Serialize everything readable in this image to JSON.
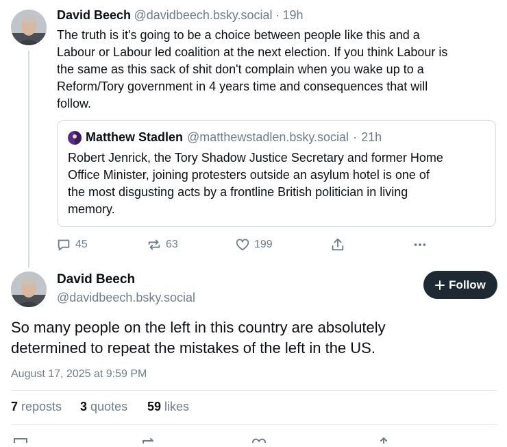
{
  "parent_post": {
    "author_name": "David Beech",
    "author_handle": "@davidbeech.bsky.social",
    "separator": "·",
    "time": "19h",
    "lines": [
      "The truth is it's going to be a choice between people like this and a",
      "Labour or Labour led coalition at the next election. If you think Labour is",
      "the same as this sack of shit don't complain when you wake up to a",
      "Reform/Tory government in 4 years time and consequences that will",
      "follow."
    ],
    "quote": {
      "author_name": "Matthew Stadlen",
      "author_handle": "@matthewstadlen.bsky.social",
      "separator": "·",
      "time": "21h",
      "lines": [
        "Robert Jenrick, the Tory Shadow Justice Secretary and former Home",
        "Office Minister, joining protesters outside an asylum hotel is one of",
        "the most disgusting acts by a frontline British politician in living",
        "memory."
      ]
    },
    "actions": {
      "replies": "45",
      "reposts": "63",
      "likes": "199"
    }
  },
  "main_post": {
    "author_name": "David Beech",
    "author_handle": "@davidbeech.bsky.social",
    "follow_label": "Follow",
    "lines": [
      "So many people on the left in this country are absolutely",
      "determined to repeat the mistakes of the left in the US."
    ],
    "timestamp": "August 17, 2025 at 9:59 PM",
    "stats": {
      "reposts_count": "7",
      "reposts_label": "reposts",
      "quotes_count": "3",
      "quotes_label": "quotes",
      "likes_count": "59",
      "likes_label": "likes"
    }
  },
  "colors": {
    "text": "#0b0f14",
    "muted": "#6f7c89",
    "border": "#d4dbe2",
    "follow_bg": "#1e2934"
  }
}
